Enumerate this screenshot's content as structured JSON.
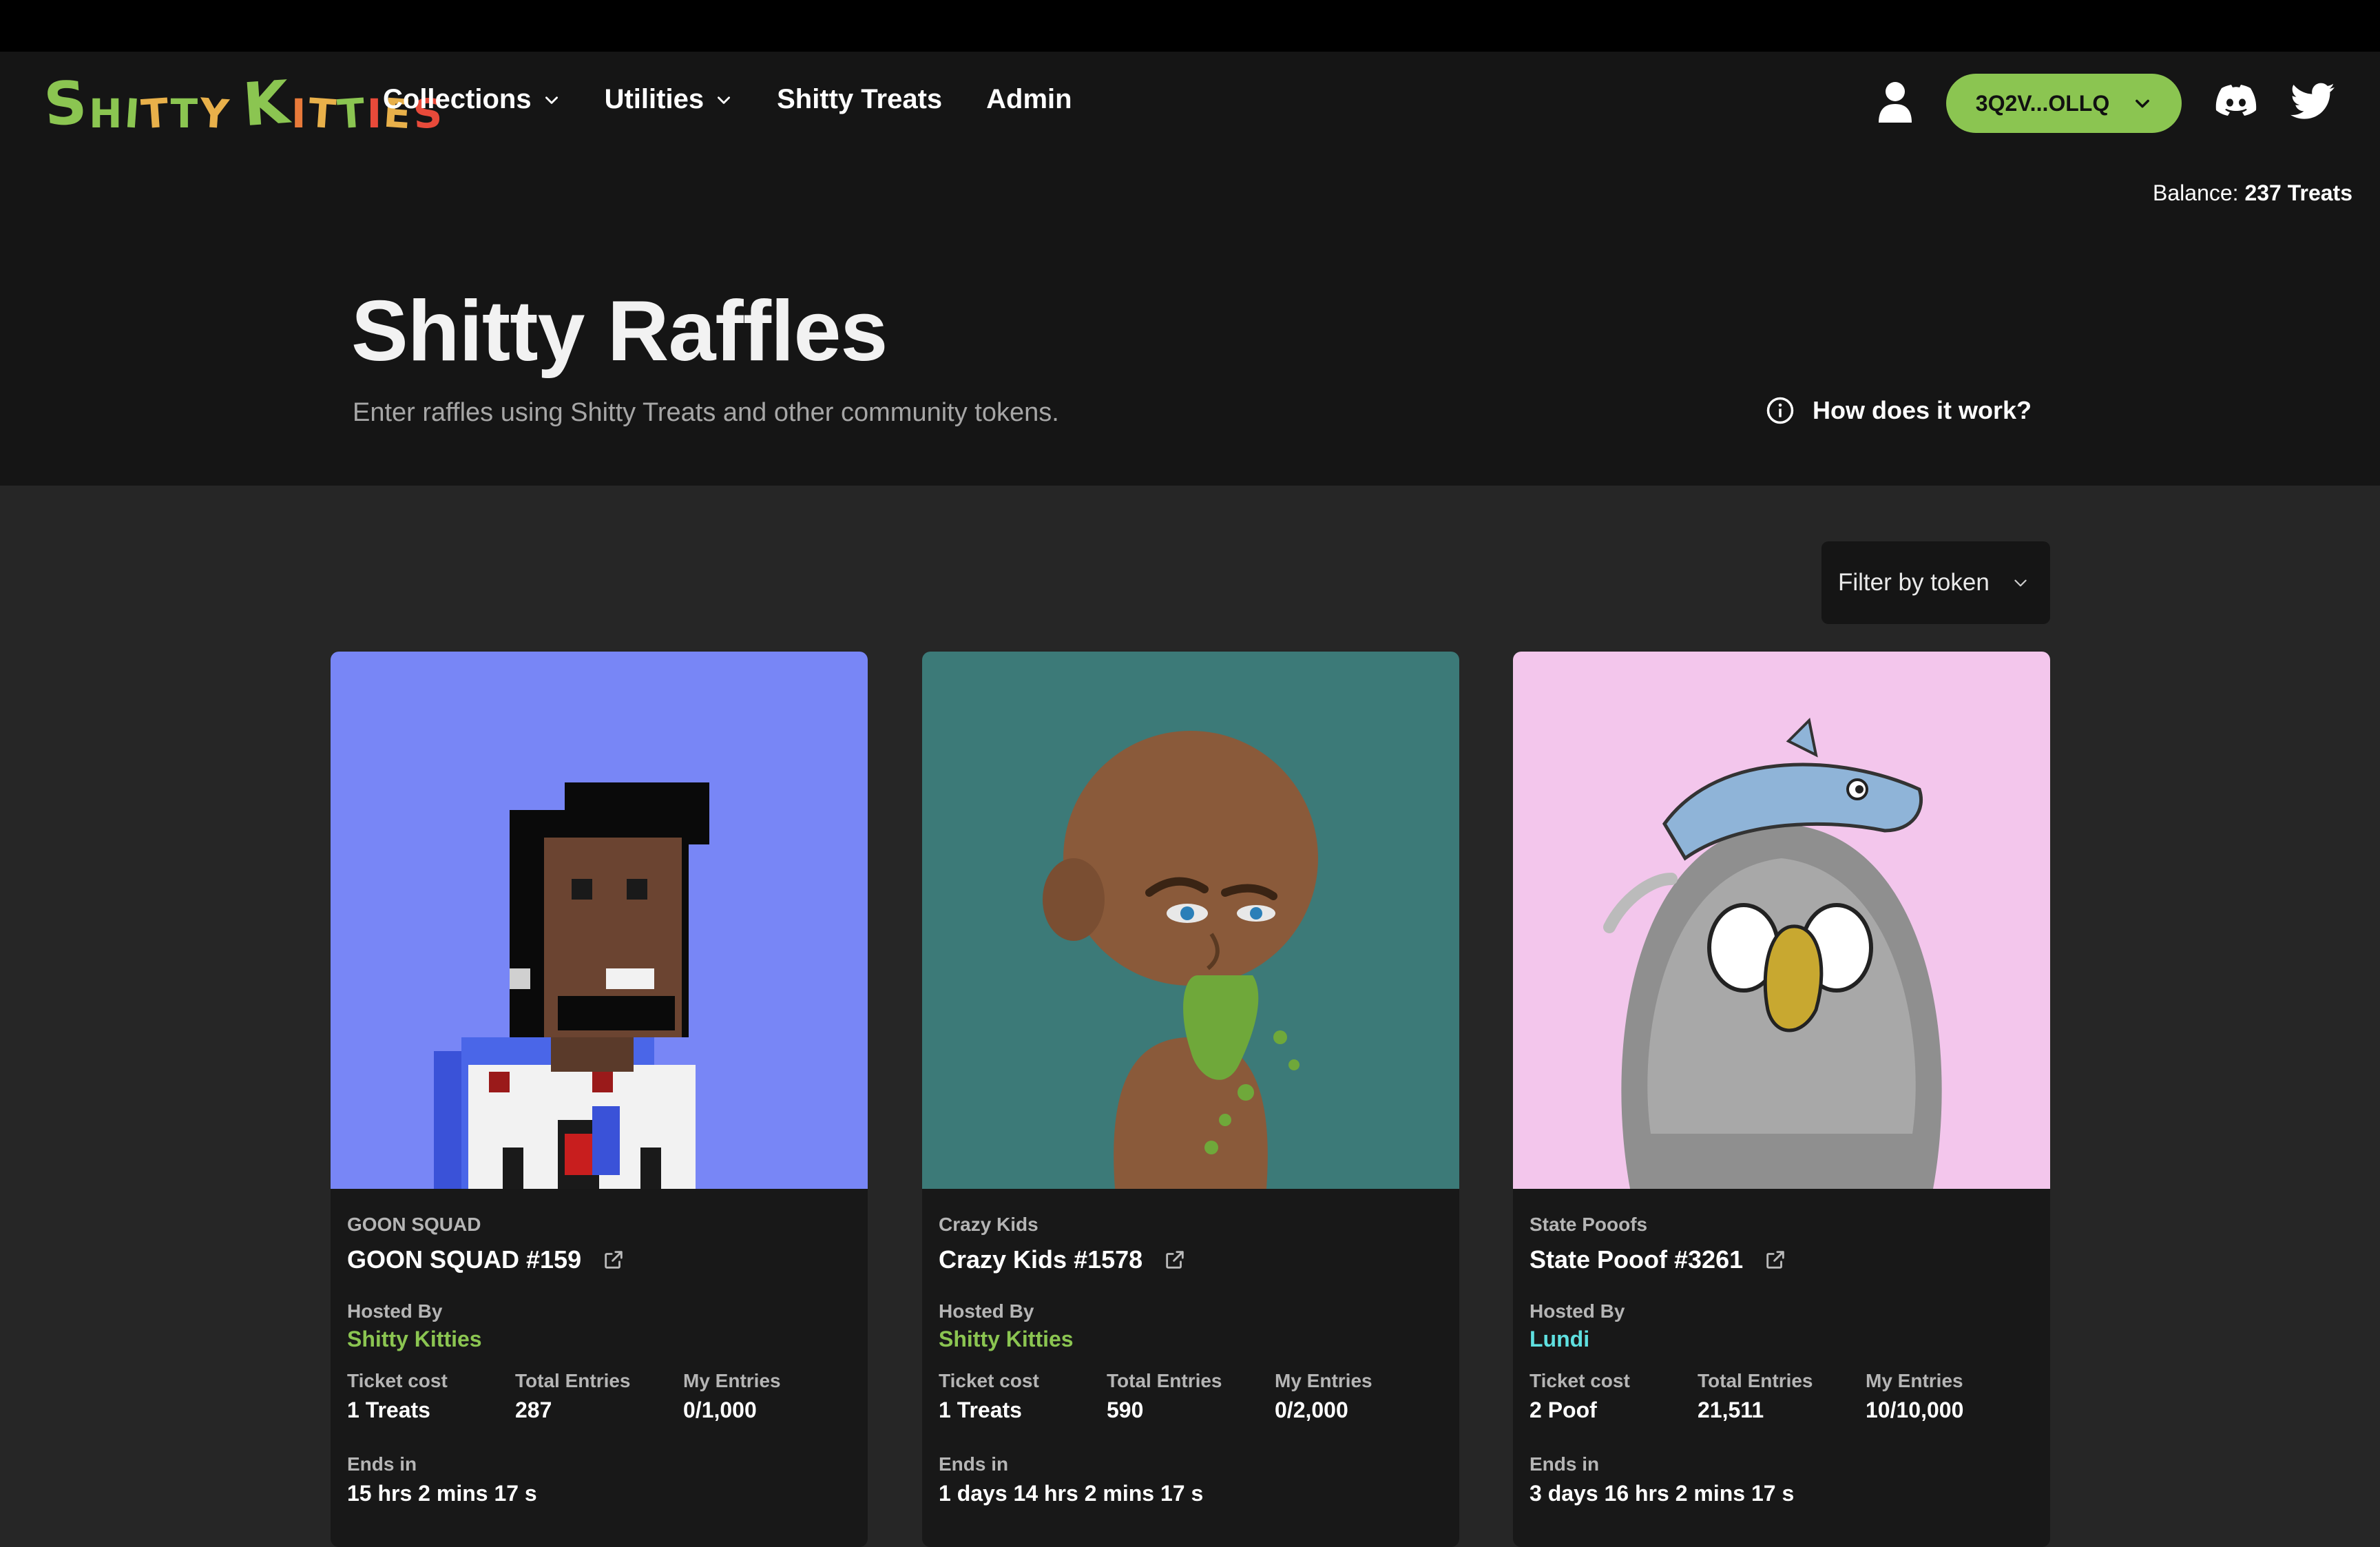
{
  "brand": {
    "logo_text": "Shitty Kitties",
    "logo_letters": [
      {
        "ch": "S",
        "color": "#8bc551"
      },
      {
        "ch": "H",
        "color": "#8bc551"
      },
      {
        "ch": "I",
        "color": "#8bc551"
      },
      {
        "ch": "T",
        "color": "#e8b04a"
      },
      {
        "ch": "T",
        "color": "#8bc551"
      },
      {
        "ch": "Y",
        "color": "#e8b04a"
      },
      {
        "ch": "K",
        "color": "#8bc551"
      },
      {
        "ch": "I",
        "color": "#e87a3a"
      },
      {
        "ch": "T",
        "color": "#e8b04a"
      },
      {
        "ch": "T",
        "color": "#8bc551"
      },
      {
        "ch": "I",
        "color": "#e84a3a"
      },
      {
        "ch": "E",
        "color": "#e8b04a"
      },
      {
        "ch": "S",
        "color": "#e84a3a"
      }
    ]
  },
  "nav": {
    "collections": "Collections",
    "utilities": "Utilities",
    "treats": "Shitty Treats",
    "admin": "Admin"
  },
  "header": {
    "wallet": "3Q2V...OLLQ",
    "balance_label": "Balance:",
    "balance_value": "237 Treats",
    "icons": [
      "user-icon",
      "discord-icon",
      "twitter-icon"
    ]
  },
  "page": {
    "title": "Shitty Raffles",
    "subtitle": "Enter raffles using Shitty Treats and other community tokens.",
    "how_link": "How does it work?",
    "filter": "Filter by token"
  },
  "labels": {
    "hosted_by": "Hosted By",
    "ticket_cost": "Ticket cost",
    "total_entries": "Total Entries",
    "my_entries": "My Entries",
    "ends_in": "Ends in"
  },
  "colors": {
    "accent_green": "#8bc551",
    "host_cyan": "#5fe0e0",
    "card1_bg": "#7886f6",
    "card2_bg": "#3c7a78",
    "card3_bg": "#f3c6ec"
  },
  "raffles": [
    {
      "collection": "GOON SQUAD",
      "title": "GOON SQUAD #159",
      "host": "Shitty Kitties",
      "ticket_cost": "1 Treats",
      "total_entries": "287",
      "my_entries": "0/1,000",
      "ends_in": "15 hrs 2 mins 17 s"
    },
    {
      "collection": "Crazy Kids",
      "title": "Crazy Kids #1578",
      "host": "Shitty Kitties",
      "ticket_cost": "1 Treats",
      "total_entries": "590",
      "my_entries": "0/2,000",
      "ends_in": "1 days 14 hrs 2 mins 17 s"
    },
    {
      "collection": "State Pooofs",
      "title": "State Pooof #3261",
      "host": "Lundi",
      "ticket_cost": "2 Poof",
      "total_entries": "21,511",
      "my_entries": "10/10,000",
      "ends_in": "3 days 16 hrs 2 mins 17 s"
    }
  ]
}
